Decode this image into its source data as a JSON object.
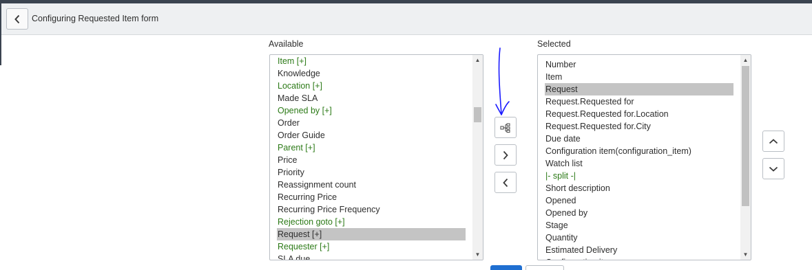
{
  "header": {
    "title": "Configuring Requested Item form"
  },
  "available": {
    "label": "Available",
    "items": [
      {
        "text": "Item [+]",
        "green": true
      },
      {
        "text": "Knowledge",
        "green": false
      },
      {
        "text": "Location [+]",
        "green": true
      },
      {
        "text": "Made SLA",
        "green": false
      },
      {
        "text": "Opened by [+]",
        "green": true
      },
      {
        "text": "Order",
        "green": false
      },
      {
        "text": "Order Guide",
        "green": false
      },
      {
        "text": "Parent [+]",
        "green": true
      },
      {
        "text": "Price",
        "green": false
      },
      {
        "text": "Priority",
        "green": false
      },
      {
        "text": "Reassignment count",
        "green": false
      },
      {
        "text": "Recurring Price",
        "green": false
      },
      {
        "text": "Recurring Price Frequency",
        "green": false
      },
      {
        "text": "Rejection goto [+]",
        "green": true
      },
      {
        "text": "Request [+]",
        "green": false,
        "selected": true
      },
      {
        "text": "Requester [+]",
        "green": true
      },
      {
        "text": "SLA due",
        "green": false
      }
    ]
  },
  "selected": {
    "label": "Selected",
    "items": [
      {
        "text": "Number"
      },
      {
        "text": "Item"
      },
      {
        "text": "Request",
        "selected": true
      },
      {
        "text": "Request.Requested for"
      },
      {
        "text": "Request.Requested for.Location"
      },
      {
        "text": "Request.Requested for.City"
      },
      {
        "text": "Due date"
      },
      {
        "text": "Configuration item(configuration_item)"
      },
      {
        "text": "Watch list"
      },
      {
        "text": "|- split -|",
        "green": true
      },
      {
        "text": "Short description"
      },
      {
        "text": "Opened"
      },
      {
        "text": "Opened by"
      },
      {
        "text": "Stage"
      },
      {
        "text": "Quantity"
      },
      {
        "text": "Estimated Delivery"
      },
      {
        "text": "Configuration item"
      }
    ]
  },
  "icons": {
    "back": "chevron-left-icon",
    "dot_walk": "tree-icon",
    "add": "chevron-right-icon",
    "remove": "chevron-left-icon",
    "move_up": "chevron-up-icon",
    "move_down": "chevron-down-icon",
    "annotation": "hand-drawn-arrow"
  },
  "colors": {
    "field_reference": "#2c7a17",
    "selection": "#c4c4c4",
    "annotation": "#1a1aff",
    "primary_button": "#1f6fd1"
  }
}
